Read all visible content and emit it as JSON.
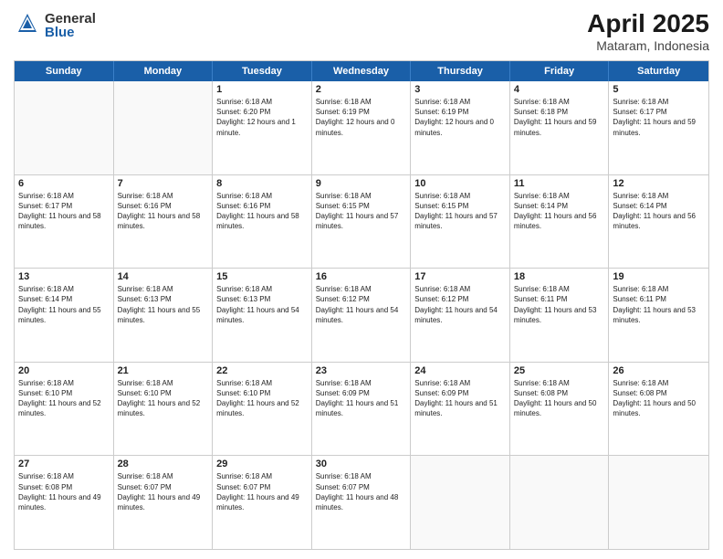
{
  "header": {
    "logo": {
      "line1": "General",
      "line2": "Blue"
    },
    "title": "April 2025",
    "location": "Mataram, Indonesia"
  },
  "calendar": {
    "days_of_week": [
      "Sunday",
      "Monday",
      "Tuesday",
      "Wednesday",
      "Thursday",
      "Friday",
      "Saturday"
    ],
    "rows": [
      [
        {
          "day": "",
          "empty": true
        },
        {
          "day": "",
          "empty": true
        },
        {
          "day": "1",
          "sunrise": "Sunrise: 6:18 AM",
          "sunset": "Sunset: 6:20 PM",
          "daylight": "Daylight: 12 hours and 1 minute."
        },
        {
          "day": "2",
          "sunrise": "Sunrise: 6:18 AM",
          "sunset": "Sunset: 6:19 PM",
          "daylight": "Daylight: 12 hours and 0 minutes."
        },
        {
          "day": "3",
          "sunrise": "Sunrise: 6:18 AM",
          "sunset": "Sunset: 6:19 PM",
          "daylight": "Daylight: 12 hours and 0 minutes."
        },
        {
          "day": "4",
          "sunrise": "Sunrise: 6:18 AM",
          "sunset": "Sunset: 6:18 PM",
          "daylight": "Daylight: 11 hours and 59 minutes."
        },
        {
          "day": "5",
          "sunrise": "Sunrise: 6:18 AM",
          "sunset": "Sunset: 6:17 PM",
          "daylight": "Daylight: 11 hours and 59 minutes."
        }
      ],
      [
        {
          "day": "6",
          "sunrise": "Sunrise: 6:18 AM",
          "sunset": "Sunset: 6:17 PM",
          "daylight": "Daylight: 11 hours and 58 minutes."
        },
        {
          "day": "7",
          "sunrise": "Sunrise: 6:18 AM",
          "sunset": "Sunset: 6:16 PM",
          "daylight": "Daylight: 11 hours and 58 minutes."
        },
        {
          "day": "8",
          "sunrise": "Sunrise: 6:18 AM",
          "sunset": "Sunset: 6:16 PM",
          "daylight": "Daylight: 11 hours and 58 minutes."
        },
        {
          "day": "9",
          "sunrise": "Sunrise: 6:18 AM",
          "sunset": "Sunset: 6:15 PM",
          "daylight": "Daylight: 11 hours and 57 minutes."
        },
        {
          "day": "10",
          "sunrise": "Sunrise: 6:18 AM",
          "sunset": "Sunset: 6:15 PM",
          "daylight": "Daylight: 11 hours and 57 minutes."
        },
        {
          "day": "11",
          "sunrise": "Sunrise: 6:18 AM",
          "sunset": "Sunset: 6:14 PM",
          "daylight": "Daylight: 11 hours and 56 minutes."
        },
        {
          "day": "12",
          "sunrise": "Sunrise: 6:18 AM",
          "sunset": "Sunset: 6:14 PM",
          "daylight": "Daylight: 11 hours and 56 minutes."
        }
      ],
      [
        {
          "day": "13",
          "sunrise": "Sunrise: 6:18 AM",
          "sunset": "Sunset: 6:14 PM",
          "daylight": "Daylight: 11 hours and 55 minutes."
        },
        {
          "day": "14",
          "sunrise": "Sunrise: 6:18 AM",
          "sunset": "Sunset: 6:13 PM",
          "daylight": "Daylight: 11 hours and 55 minutes."
        },
        {
          "day": "15",
          "sunrise": "Sunrise: 6:18 AM",
          "sunset": "Sunset: 6:13 PM",
          "daylight": "Daylight: 11 hours and 54 minutes."
        },
        {
          "day": "16",
          "sunrise": "Sunrise: 6:18 AM",
          "sunset": "Sunset: 6:12 PM",
          "daylight": "Daylight: 11 hours and 54 minutes."
        },
        {
          "day": "17",
          "sunrise": "Sunrise: 6:18 AM",
          "sunset": "Sunset: 6:12 PM",
          "daylight": "Daylight: 11 hours and 54 minutes."
        },
        {
          "day": "18",
          "sunrise": "Sunrise: 6:18 AM",
          "sunset": "Sunset: 6:11 PM",
          "daylight": "Daylight: 11 hours and 53 minutes."
        },
        {
          "day": "19",
          "sunrise": "Sunrise: 6:18 AM",
          "sunset": "Sunset: 6:11 PM",
          "daylight": "Daylight: 11 hours and 53 minutes."
        }
      ],
      [
        {
          "day": "20",
          "sunrise": "Sunrise: 6:18 AM",
          "sunset": "Sunset: 6:10 PM",
          "daylight": "Daylight: 11 hours and 52 minutes."
        },
        {
          "day": "21",
          "sunrise": "Sunrise: 6:18 AM",
          "sunset": "Sunset: 6:10 PM",
          "daylight": "Daylight: 11 hours and 52 minutes."
        },
        {
          "day": "22",
          "sunrise": "Sunrise: 6:18 AM",
          "sunset": "Sunset: 6:10 PM",
          "daylight": "Daylight: 11 hours and 52 minutes."
        },
        {
          "day": "23",
          "sunrise": "Sunrise: 6:18 AM",
          "sunset": "Sunset: 6:09 PM",
          "daylight": "Daylight: 11 hours and 51 minutes."
        },
        {
          "day": "24",
          "sunrise": "Sunrise: 6:18 AM",
          "sunset": "Sunset: 6:09 PM",
          "daylight": "Daylight: 11 hours and 51 minutes."
        },
        {
          "day": "25",
          "sunrise": "Sunrise: 6:18 AM",
          "sunset": "Sunset: 6:08 PM",
          "daylight": "Daylight: 11 hours and 50 minutes."
        },
        {
          "day": "26",
          "sunrise": "Sunrise: 6:18 AM",
          "sunset": "Sunset: 6:08 PM",
          "daylight": "Daylight: 11 hours and 50 minutes."
        }
      ],
      [
        {
          "day": "27",
          "sunrise": "Sunrise: 6:18 AM",
          "sunset": "Sunset: 6:08 PM",
          "daylight": "Daylight: 11 hours and 49 minutes."
        },
        {
          "day": "28",
          "sunrise": "Sunrise: 6:18 AM",
          "sunset": "Sunset: 6:07 PM",
          "daylight": "Daylight: 11 hours and 49 minutes."
        },
        {
          "day": "29",
          "sunrise": "Sunrise: 6:18 AM",
          "sunset": "Sunset: 6:07 PM",
          "daylight": "Daylight: 11 hours and 49 minutes."
        },
        {
          "day": "30",
          "sunrise": "Sunrise: 6:18 AM",
          "sunset": "Sunset: 6:07 PM",
          "daylight": "Daylight: 11 hours and 48 minutes."
        },
        {
          "day": "",
          "empty": true
        },
        {
          "day": "",
          "empty": true
        },
        {
          "day": "",
          "empty": true
        }
      ]
    ]
  }
}
